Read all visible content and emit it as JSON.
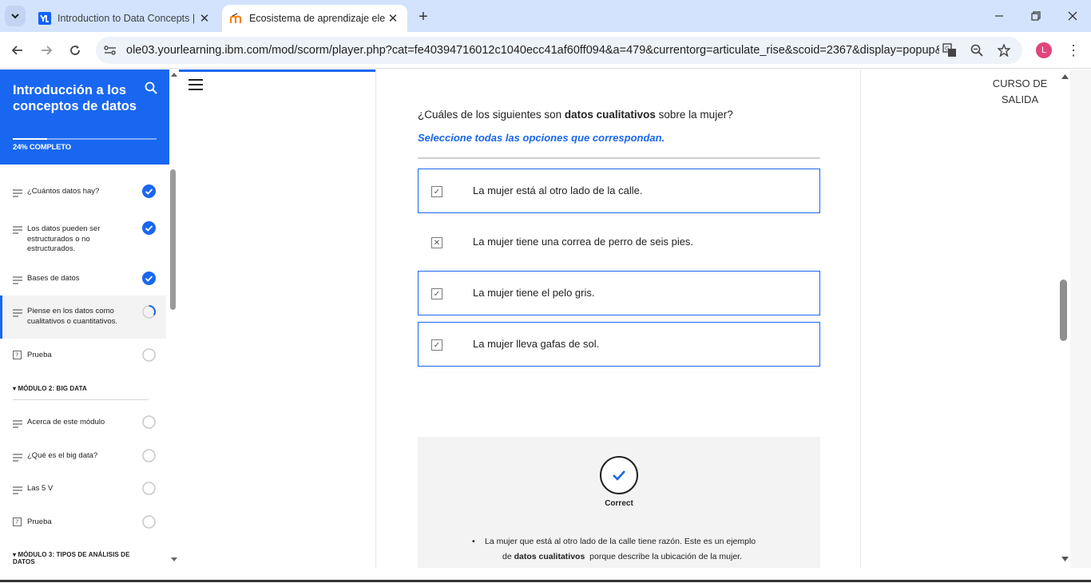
{
  "browser": {
    "tabs": [
      {
        "title": "Introduction to Data Concepts |",
        "active": false
      },
      {
        "title": "Ecosistema de aprendizaje elect",
        "active": true
      }
    ],
    "url": "ole03.yourlearning.ibm.com/mod/scorm/player.php?cat=fe40394716012c1040ecc41af60ff094&a=479&currentorg=articulate_rise&scoid=2367&display=popup&...",
    "profile_initial": "L",
    "colors": {
      "tabstrip": "#d3e3fd",
      "accent": "#1967f0"
    }
  },
  "sidebar": {
    "title": "Introducción a los conceptos de datos",
    "progress_text": "24% COMPLETO",
    "progress_fraction": 0.24,
    "lessons": [
      {
        "label": "¿Cuántos datos hay?",
        "status": "complete"
      },
      {
        "label": "Los datos pueden ser estructurados o no estructurados.",
        "status": "complete"
      },
      {
        "label": "Bases de datos",
        "status": "complete"
      },
      {
        "label": "Piense en los datos como cualitativos o cuantitativos.",
        "status": "in-progress"
      },
      {
        "label": "Prueba",
        "status": "not-started"
      }
    ],
    "module2": {
      "title": "MÓDULO 2: BIG DATA",
      "lessons": [
        {
          "label": "Acerca de este módulo",
          "status": "not-started"
        },
        {
          "label": "¿Qué es el big data?",
          "status": "not-started"
        },
        {
          "label": "Las 5 V",
          "status": "not-started"
        },
        {
          "label": "Prueba",
          "status": "not-started"
        }
      ]
    },
    "module3": {
      "title": "MÓDULO 3: TIPOS DE ANÁLISIS DE DATOS"
    }
  },
  "main": {
    "exit_label": "CURSO DE SALIDA",
    "question_prefix": "¿Cuáles de los siguientes son ",
    "question_bold": "datos cualitativos",
    "question_suffix": " sobre la mujer?",
    "instruction": "Seleccione todas las opciones que correspondan.",
    "options": [
      {
        "text": "La mujer está al otro lado de la calle.",
        "mark": "check",
        "selected": true
      },
      {
        "text": "La mujer tiene una correa de perro de seis pies.",
        "mark": "cross",
        "selected": false
      },
      {
        "text": "La mujer tiene el pelo gris.",
        "mark": "check",
        "selected": true
      },
      {
        "text": "La mujer lleva gafas de sol.",
        "mark": "check",
        "selected": true
      }
    ],
    "feedback": {
      "label": "Correct",
      "line1": "La mujer que está al otro lado de la calle tiene razón. Este es un ejemplo",
      "line2_prefix": "de ",
      "line2_bold": "datos cualitativos",
      "line2_suffix": "  porque describe la ubicación de la mujer."
    }
  }
}
